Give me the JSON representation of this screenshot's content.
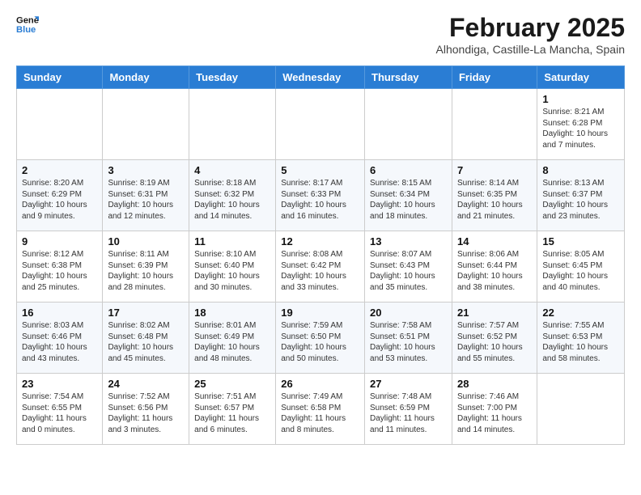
{
  "header": {
    "logo_line1": "General",
    "logo_line2": "Blue",
    "month": "February 2025",
    "location": "Alhondiga, Castille-La Mancha, Spain"
  },
  "weekdays": [
    "Sunday",
    "Monday",
    "Tuesday",
    "Wednesday",
    "Thursday",
    "Friday",
    "Saturday"
  ],
  "weeks": [
    [
      {
        "day": "",
        "info": ""
      },
      {
        "day": "",
        "info": ""
      },
      {
        "day": "",
        "info": ""
      },
      {
        "day": "",
        "info": ""
      },
      {
        "day": "",
        "info": ""
      },
      {
        "day": "",
        "info": ""
      },
      {
        "day": "1",
        "info": "Sunrise: 8:21 AM\nSunset: 6:28 PM\nDaylight: 10 hours\nand 7 minutes."
      }
    ],
    [
      {
        "day": "2",
        "info": "Sunrise: 8:20 AM\nSunset: 6:29 PM\nDaylight: 10 hours\nand 9 minutes."
      },
      {
        "day": "3",
        "info": "Sunrise: 8:19 AM\nSunset: 6:31 PM\nDaylight: 10 hours\nand 12 minutes."
      },
      {
        "day": "4",
        "info": "Sunrise: 8:18 AM\nSunset: 6:32 PM\nDaylight: 10 hours\nand 14 minutes."
      },
      {
        "day": "5",
        "info": "Sunrise: 8:17 AM\nSunset: 6:33 PM\nDaylight: 10 hours\nand 16 minutes."
      },
      {
        "day": "6",
        "info": "Sunrise: 8:15 AM\nSunset: 6:34 PM\nDaylight: 10 hours\nand 18 minutes."
      },
      {
        "day": "7",
        "info": "Sunrise: 8:14 AM\nSunset: 6:35 PM\nDaylight: 10 hours\nand 21 minutes."
      },
      {
        "day": "8",
        "info": "Sunrise: 8:13 AM\nSunset: 6:37 PM\nDaylight: 10 hours\nand 23 minutes."
      }
    ],
    [
      {
        "day": "9",
        "info": "Sunrise: 8:12 AM\nSunset: 6:38 PM\nDaylight: 10 hours\nand 25 minutes."
      },
      {
        "day": "10",
        "info": "Sunrise: 8:11 AM\nSunset: 6:39 PM\nDaylight: 10 hours\nand 28 minutes."
      },
      {
        "day": "11",
        "info": "Sunrise: 8:10 AM\nSunset: 6:40 PM\nDaylight: 10 hours\nand 30 minutes."
      },
      {
        "day": "12",
        "info": "Sunrise: 8:08 AM\nSunset: 6:42 PM\nDaylight: 10 hours\nand 33 minutes."
      },
      {
        "day": "13",
        "info": "Sunrise: 8:07 AM\nSunset: 6:43 PM\nDaylight: 10 hours\nand 35 minutes."
      },
      {
        "day": "14",
        "info": "Sunrise: 8:06 AM\nSunset: 6:44 PM\nDaylight: 10 hours\nand 38 minutes."
      },
      {
        "day": "15",
        "info": "Sunrise: 8:05 AM\nSunset: 6:45 PM\nDaylight: 10 hours\nand 40 minutes."
      }
    ],
    [
      {
        "day": "16",
        "info": "Sunrise: 8:03 AM\nSunset: 6:46 PM\nDaylight: 10 hours\nand 43 minutes."
      },
      {
        "day": "17",
        "info": "Sunrise: 8:02 AM\nSunset: 6:48 PM\nDaylight: 10 hours\nand 45 minutes."
      },
      {
        "day": "18",
        "info": "Sunrise: 8:01 AM\nSunset: 6:49 PM\nDaylight: 10 hours\nand 48 minutes."
      },
      {
        "day": "19",
        "info": "Sunrise: 7:59 AM\nSunset: 6:50 PM\nDaylight: 10 hours\nand 50 minutes."
      },
      {
        "day": "20",
        "info": "Sunrise: 7:58 AM\nSunset: 6:51 PM\nDaylight: 10 hours\nand 53 minutes."
      },
      {
        "day": "21",
        "info": "Sunrise: 7:57 AM\nSunset: 6:52 PM\nDaylight: 10 hours\nand 55 minutes."
      },
      {
        "day": "22",
        "info": "Sunrise: 7:55 AM\nSunset: 6:53 PM\nDaylight: 10 hours\nand 58 minutes."
      }
    ],
    [
      {
        "day": "23",
        "info": "Sunrise: 7:54 AM\nSunset: 6:55 PM\nDaylight: 11 hours\nand 0 minutes."
      },
      {
        "day": "24",
        "info": "Sunrise: 7:52 AM\nSunset: 6:56 PM\nDaylight: 11 hours\nand 3 minutes."
      },
      {
        "day": "25",
        "info": "Sunrise: 7:51 AM\nSunset: 6:57 PM\nDaylight: 11 hours\nand 6 minutes."
      },
      {
        "day": "26",
        "info": "Sunrise: 7:49 AM\nSunset: 6:58 PM\nDaylight: 11 hours\nand 8 minutes."
      },
      {
        "day": "27",
        "info": "Sunrise: 7:48 AM\nSunset: 6:59 PM\nDaylight: 11 hours\nand 11 minutes."
      },
      {
        "day": "28",
        "info": "Sunrise: 7:46 AM\nSunset: 7:00 PM\nDaylight: 11 hours\nand 14 minutes."
      },
      {
        "day": "",
        "info": ""
      }
    ]
  ]
}
